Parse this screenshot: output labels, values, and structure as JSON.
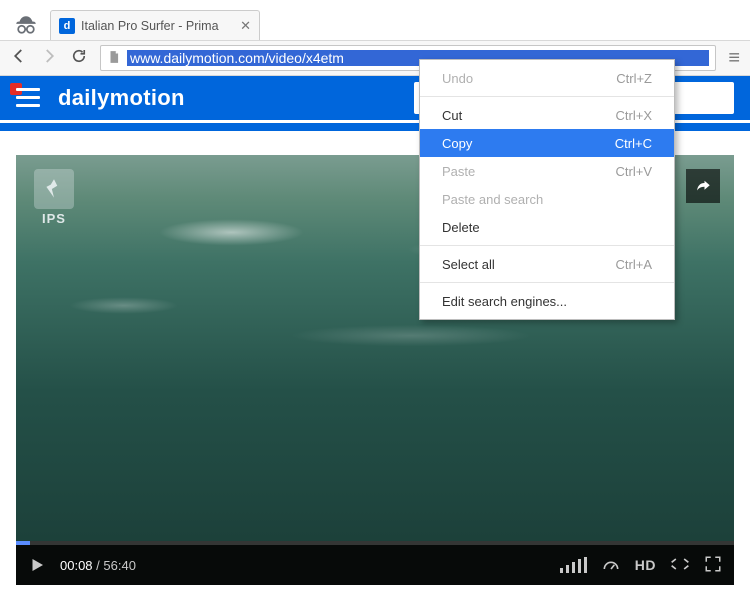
{
  "tab": {
    "title": "Italian Pro Surfer - Prima ",
    "favicon_letter": "d"
  },
  "address_bar": {
    "url": "www.dailymotion.com/video/x4etm"
  },
  "dm": {
    "logo": "dailymotion"
  },
  "video": {
    "watermark": "IPS",
    "current_time": "00:08",
    "duration": "56:40",
    "hd_label": "HD"
  },
  "context_menu": {
    "items": [
      {
        "label": "Undo",
        "shortcut": "Ctrl+Z",
        "disabled": true
      },
      {
        "sep": true
      },
      {
        "label": "Cut",
        "shortcut": "Ctrl+X"
      },
      {
        "label": "Copy",
        "shortcut": "Ctrl+C",
        "selected": true
      },
      {
        "label": "Paste",
        "shortcut": "Ctrl+V",
        "disabled": true
      },
      {
        "label": "Paste and search",
        "disabled": true
      },
      {
        "label": "Delete"
      },
      {
        "sep": true
      },
      {
        "label": "Select all",
        "shortcut": "Ctrl+A"
      },
      {
        "sep": true
      },
      {
        "label": "Edit search engines..."
      }
    ]
  }
}
